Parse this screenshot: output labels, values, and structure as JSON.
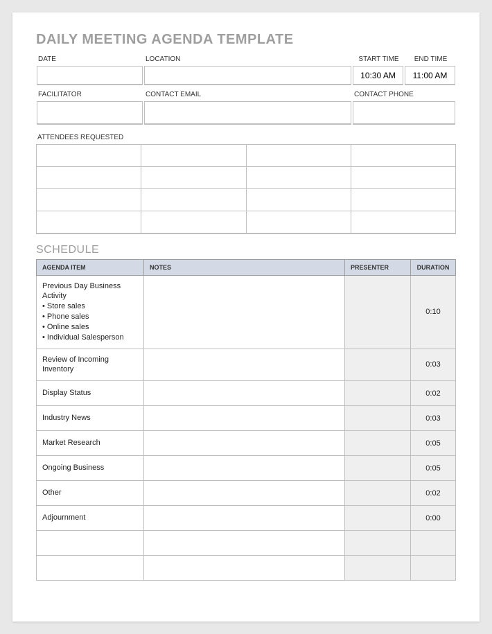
{
  "title": "DAILY MEETING AGENDA TEMPLATE",
  "meta1": {
    "labels": {
      "date": "DATE",
      "location": "LOCATION",
      "start": "START TIME",
      "end": "END TIME"
    },
    "values": {
      "date": "",
      "location": "",
      "start": "10:30 AM",
      "end": "11:00 AM"
    }
  },
  "meta2": {
    "labels": {
      "facilitator": "FACILITATOR",
      "email": "CONTACT EMAIL",
      "phone": "CONTACT PHONE"
    },
    "values": {
      "facilitator": "",
      "email": "",
      "phone": ""
    }
  },
  "attendees_label": "ATTENDEES REQUESTED",
  "schedule_title": "SCHEDULE",
  "schedule_headers": {
    "item": "AGENDA ITEM",
    "notes": "NOTES",
    "presenter": "PRESENTER",
    "duration": "DURATION"
  },
  "schedule_rows": [
    {
      "item": "Previous Day Business Activity\n• Store sales\n• Phone sales\n• Online sales\n• Individual Salesperson",
      "notes": "",
      "presenter": "",
      "duration": "0:10"
    },
    {
      "item": "Review of Incoming Inventory",
      "notes": "",
      "presenter": "",
      "duration": "0:03"
    },
    {
      "item": "Display Status",
      "notes": "",
      "presenter": "",
      "duration": "0:02"
    },
    {
      "item": "Industry News",
      "notes": "",
      "presenter": "",
      "duration": "0:03"
    },
    {
      "item": "Market Research",
      "notes": "",
      "presenter": "",
      "duration": "0:05"
    },
    {
      "item": "Ongoing Business",
      "notes": "",
      "presenter": "",
      "duration": "0:05"
    },
    {
      "item": "Other",
      "notes": "",
      "presenter": "",
      "duration": "0:02"
    },
    {
      "item": "Adjournment",
      "notes": "",
      "presenter": "",
      "duration": "0:00"
    },
    {
      "item": "",
      "notes": "",
      "presenter": "",
      "duration": ""
    },
    {
      "item": "",
      "notes": "",
      "presenter": "",
      "duration": ""
    }
  ]
}
